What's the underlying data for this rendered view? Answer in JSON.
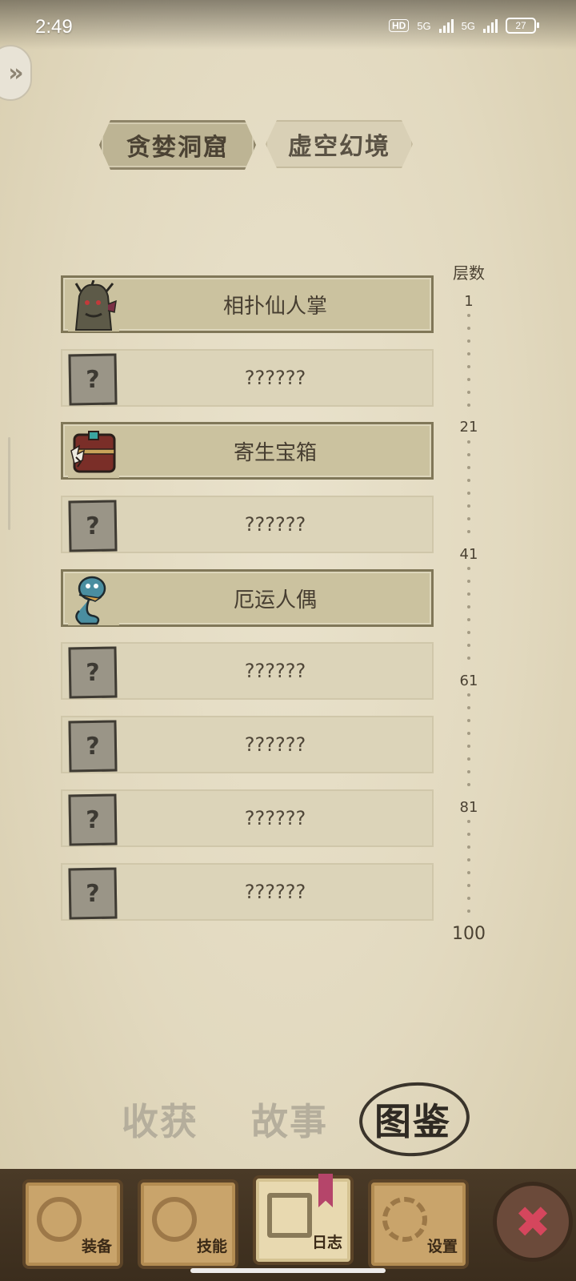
{
  "status_bar": {
    "time": "2:49",
    "hd_label": "HD",
    "network1": "5G",
    "network2": "5G",
    "battery": "27"
  },
  "map_tabs": [
    {
      "label": "贪婪洞窟",
      "active": true
    },
    {
      "label": "虚空幻境",
      "active": false
    }
  ],
  "list": {
    "layer_header": "层数",
    "rows": [
      {
        "name": "相扑仙人掌",
        "unlocked": true,
        "icon": "cactus-monster-icon"
      },
      {
        "name": "??????",
        "unlocked": false,
        "icon": "question-card-icon"
      },
      {
        "name": "寄生宝箱",
        "unlocked": true,
        "icon": "mimic-chest-icon"
      },
      {
        "name": "??????",
        "unlocked": false,
        "icon": "question-card-icon"
      },
      {
        "name": "厄运人偶",
        "unlocked": true,
        "icon": "doom-doll-icon"
      },
      {
        "name": "??????",
        "unlocked": false,
        "icon": "question-card-icon"
      },
      {
        "name": "??????",
        "unlocked": false,
        "icon": "question-card-icon"
      },
      {
        "name": "??????",
        "unlocked": false,
        "icon": "question-card-icon"
      },
      {
        "name": "??????",
        "unlocked": false,
        "icon": "question-card-icon"
      }
    ],
    "question_mark": "?",
    "layer_marks": [
      "1",
      "21",
      "41",
      "61",
      "81",
      "100"
    ]
  },
  "page_tabs": [
    {
      "label": "收获",
      "active": false
    },
    {
      "label": "故事",
      "active": false
    },
    {
      "label": "图鉴",
      "active": true
    }
  ],
  "bottom_nav": [
    {
      "label": "装备",
      "icon": "axe-icon"
    },
    {
      "label": "技能",
      "icon": "skill-icon"
    },
    {
      "label": "日志",
      "icon": "journal-icon",
      "active": true
    },
    {
      "label": "设置",
      "icon": "gear-icon"
    }
  ],
  "close_button": {
    "glyph": "✖"
  },
  "back_button": {
    "glyph": "»"
  }
}
